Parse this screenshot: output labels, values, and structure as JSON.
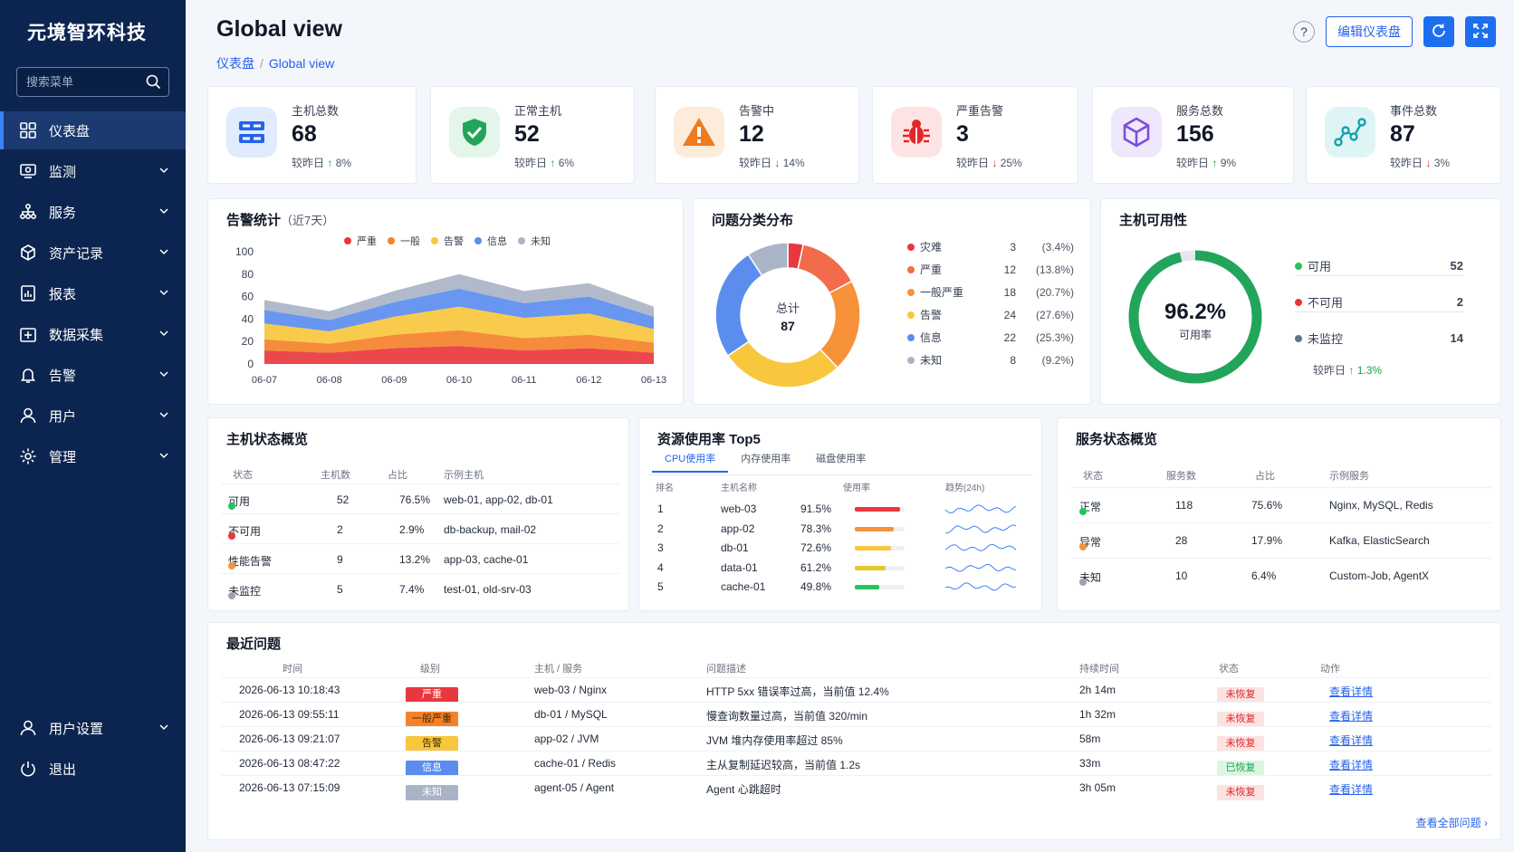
{
  "app": {
    "brand": "元境智环科技",
    "search_placeholder": "搜索菜单"
  },
  "sidebar": {
    "items": [
      {
        "label": "仪表盘",
        "icon": "dashboard-icon"
      },
      {
        "label": "监测",
        "icon": "monitor-icon"
      },
      {
        "label": "服务",
        "icon": "services-icon"
      },
      {
        "label": "资产记录",
        "icon": "asset-icon"
      },
      {
        "label": "报表",
        "icon": "report-icon"
      },
      {
        "label": "数据采集",
        "icon": "data-collect-icon"
      },
      {
        "label": "告警",
        "icon": "bell-icon"
      },
      {
        "label": "用户",
        "icon": "user-icon"
      },
      {
        "label": "管理",
        "icon": "gear-icon"
      }
    ],
    "bottom": [
      {
        "label": "用户设置",
        "icon": "user-settings-icon"
      },
      {
        "label": "退出",
        "icon": "power-icon"
      }
    ]
  },
  "header": {
    "title": "Global view",
    "breadcrumb": [
      "仪表盘",
      "Global view"
    ],
    "help": "?",
    "edit_label": "编辑仪表盘"
  },
  "stats": [
    {
      "label": "主机总数",
      "value": "68",
      "delta_prefix": "较昨日",
      "arrow": "↑",
      "delta": "8%",
      "dir": "up",
      "icon": "server-icon"
    },
    {
      "label": "正常主机",
      "value": "52",
      "delta_prefix": "较昨日",
      "arrow": "↑",
      "delta": "6%",
      "dir": "up",
      "icon": "shield-check-icon"
    },
    {
      "label": "告警中",
      "value": "12",
      "delta_prefix": "较昨日",
      "arrow": "↓",
      "delta": "14%",
      "dir": "down",
      "icon": "warning-icon"
    },
    {
      "label": "严重告警",
      "value": "3",
      "delta_prefix": "较昨日",
      "arrow": "↓",
      "delta": "25%",
      "dir": "down",
      "icon": "bug-icon"
    },
    {
      "label": "服务总数",
      "value": "156",
      "delta_prefix": "较昨日",
      "arrow": "↑",
      "delta": "9%",
      "dir": "up",
      "icon": "cube-icon"
    },
    {
      "label": "事件总数",
      "value": "87",
      "delta_prefix": "较昨日",
      "arrow": "↓",
      "delta": "3%",
      "dir": "down",
      "icon": "event-graph-icon"
    }
  ],
  "alert_chart": {
    "title": "告警统计",
    "subtitle": "（近7天）"
  },
  "chart_data": [
    {
      "type": "area",
      "stacked": true,
      "x": [
        "06-07",
        "06-08",
        "06-09",
        "06-10",
        "06-11",
        "06-12",
        "06-13"
      ],
      "ylim": [
        0,
        100
      ],
      "yticks": [
        "0",
        "20",
        "40",
        "60",
        "80",
        "100"
      ],
      "series": [
        {
          "name": "严重",
          "color": "#e8383d",
          "values": [
            12,
            10,
            14,
            16,
            12,
            14,
            10
          ]
        },
        {
          "name": "一般",
          "color": "#f5822a",
          "values": [
            10,
            8,
            12,
            14,
            11,
            12,
            9
          ]
        },
        {
          "name": "告警",
          "color": "#f9c73d",
          "values": [
            14,
            11,
            16,
            21,
            18,
            19,
            12
          ]
        },
        {
          "name": "信息",
          "color": "#5b8def",
          "values": [
            12,
            10,
            13,
            16,
            13,
            15,
            11
          ]
        },
        {
          "name": "未知",
          "color": "#a9b4c6",
          "values": [
            9,
            8,
            10,
            13,
            11,
            12,
            9
          ]
        }
      ],
      "legend": "top"
    },
    {
      "type": "pie",
      "title": "问题分类分布",
      "center_label": "总计",
      "center_value": "87",
      "slices": [
        {
          "name": "灾难",
          "value": 3,
          "pct": "(3.4%)",
          "color": "#e8383d"
        },
        {
          "name": "严重",
          "value": 12,
          "pct": "(13.8%)",
          "color": "#f26b4b"
        },
        {
          "name": "一般严重",
          "value": 18,
          "pct": "(20.7%)",
          "color": "#f7913a"
        },
        {
          "name": "告警",
          "value": 24,
          "pct": "(27.6%)",
          "color": "#f9c73d"
        },
        {
          "name": "信息",
          "value": 22,
          "pct": "(25.3%)",
          "color": "#5b8def"
        },
        {
          "name": "未知",
          "value": 8,
          "pct": "(9.2%)",
          "color": "#a9b4c6"
        }
      ]
    },
    {
      "type": "pie",
      "title": "主机可用性",
      "center_value": "96.2%",
      "center_label": "可用率",
      "slices": [
        {
          "name": "可用",
          "value": 52,
          "color": "#22c55e"
        },
        {
          "name": "不可用",
          "value": 2,
          "color": "#e8383d"
        },
        {
          "name": "未监控",
          "value": 14,
          "color": "#64748b"
        }
      ],
      "ring_fraction": 0.962,
      "delta_prefix": "较昨日",
      "delta_arrow": "↑",
      "delta": "1.3%"
    }
  ],
  "host_status": {
    "title": "主机状态概览",
    "columns": [
      "状态",
      "主机数",
      "占比",
      "示例主机"
    ],
    "rows": [
      {
        "status": "可用",
        "color": "#22c55e",
        "count": "52",
        "pct": "76.5%",
        "hosts": "web-01, app-02, db-01"
      },
      {
        "status": "不可用",
        "color": "#e8383d",
        "count": "2",
        "pct": "2.9%",
        "hosts": "db-backup, mail-02"
      },
      {
        "status": "性能告警",
        "color": "#f7913a",
        "count": "9",
        "pct": "13.2%",
        "hosts": "app-03, cache-01"
      },
      {
        "status": "未监控",
        "color": "#9ca3af",
        "count": "5",
        "pct": "7.4%",
        "hosts": "test-01, old-srv-03"
      }
    ]
  },
  "resource_top5": {
    "title": "资源使用率 Top5",
    "tabs": [
      "CPU使用率",
      "内存使用率",
      "磁盘使用率"
    ],
    "columns": [
      "排名",
      "主机名称",
      "使用率",
      "趋势(24h)"
    ],
    "rows": [
      {
        "rank": "1",
        "host": "web-03",
        "usage": "91.5%",
        "fraction": 0.915,
        "color": "#e8383d"
      },
      {
        "rank": "2",
        "host": "app-02",
        "usage": "78.3%",
        "fraction": 0.783,
        "color": "#f7913a"
      },
      {
        "rank": "3",
        "host": "db-01",
        "usage": "72.6%",
        "fraction": 0.726,
        "color": "#f9c73d"
      },
      {
        "rank": "4",
        "host": "data-01",
        "usage": "61.2%",
        "fraction": 0.612,
        "color": "#e5c72e"
      },
      {
        "rank": "5",
        "host": "cache-01",
        "usage": "49.8%",
        "fraction": 0.498,
        "color": "#22c55e"
      }
    ]
  },
  "service_status": {
    "title": "服务状态概览",
    "columns": [
      "状态",
      "服务数",
      "占比",
      "示例服务"
    ],
    "rows": [
      {
        "status": "正常",
        "color": "#22c55e",
        "count": "118",
        "pct": "75.6%",
        "examples": "Nginx, MySQL, Redis"
      },
      {
        "status": "异常",
        "color": "#f7913a",
        "count": "28",
        "pct": "17.9%",
        "examples": "Kafka, ElasticSearch"
      },
      {
        "status": "未知",
        "color": "#9ca3af",
        "count": "10",
        "pct": "6.4%",
        "examples": "Custom-Job, AgentX"
      }
    ]
  },
  "recent_issues": {
    "title": "最近问题",
    "columns": [
      "时间",
      "级别",
      "主机 / 服务",
      "问题描述",
      "持续时间",
      "状态",
      "动作"
    ],
    "rows": [
      {
        "time": "2026-06-13 10:18:43",
        "level": "严重",
        "level_color": "#e8383d",
        "host": "web-03 / Nginx",
        "desc": "HTTP 5xx 错误率过高，当前值 12.4%",
        "duration": "2h 14m",
        "state": "未恢复",
        "recovered": false,
        "action": "查看详情"
      },
      {
        "time": "2026-06-13 09:55:11",
        "level": "一般严重",
        "level_color": "#f5822a",
        "host": "db-01 / MySQL",
        "desc": "慢查询数量过高，当前值 320/min",
        "duration": "1h 32m",
        "state": "未恢复",
        "recovered": false,
        "action": "查看详情"
      },
      {
        "time": "2026-06-13 09:21:07",
        "level": "告警",
        "level_color": "#f9c73d",
        "host": "app-02 / JVM",
        "desc": "JVM 堆内存使用率超过 85%",
        "duration": "58m",
        "state": "未恢复",
        "recovered": false,
        "action": "查看详情"
      },
      {
        "time": "2026-06-13 08:47:22",
        "level": "信息",
        "level_color": "#5b8def",
        "host": "cache-01 / Redis",
        "desc": "主从复制延迟较高，当前值 1.2s",
        "duration": "33m",
        "state": "已恢复",
        "recovered": true,
        "action": "查看详情"
      },
      {
        "time": "2026-06-13 07:15:09",
        "level": "未知",
        "level_color": "#a9b4c6",
        "host": "agent-05 / Agent",
        "desc": "Agent 心跳超时",
        "duration": "3h 05m",
        "state": "未恢复",
        "recovered": false,
        "action": "查看详情"
      }
    ],
    "view_all": "查看全部问题"
  }
}
